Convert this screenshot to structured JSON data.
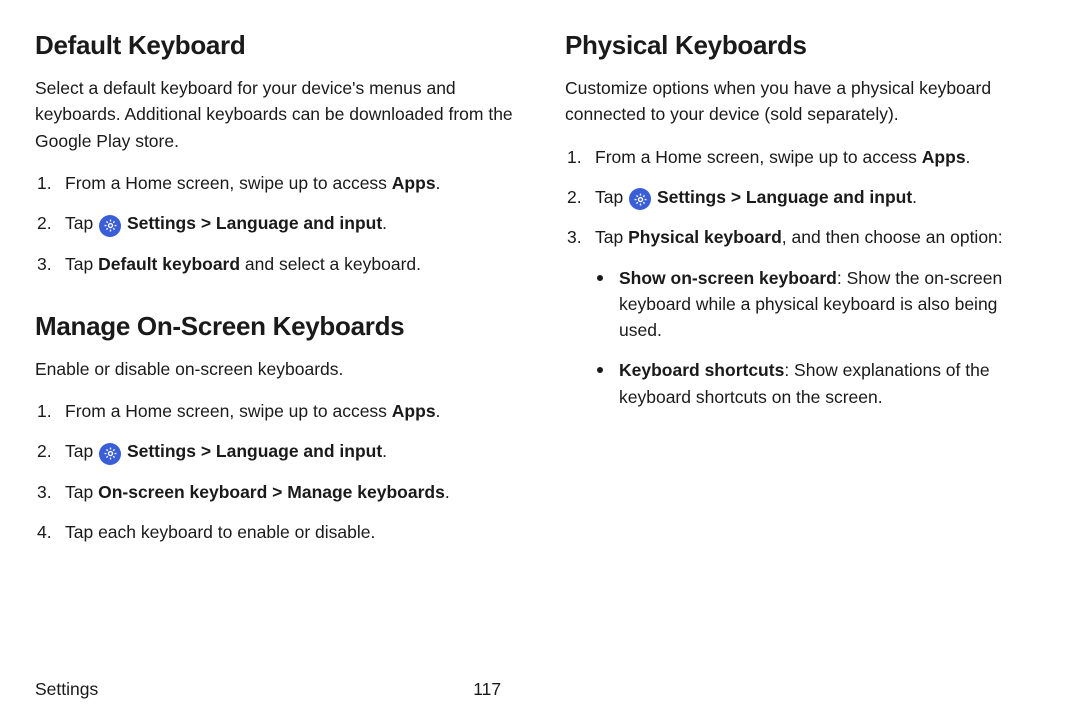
{
  "left": {
    "section1": {
      "heading": "Default Keyboard",
      "intro": "Select a default keyboard for your device's menus and keyboards. Additional keyboards can be downloaded from the Google Play store.",
      "step1_pre": "From a Home screen, swipe up to access ",
      "step1_bold": "Apps",
      "step1_post": ".",
      "step2_pre": "Tap ",
      "step2_bold": " Settings > Language and input",
      "step2_post": ".",
      "step3_pre": "Tap ",
      "step3_bold": "Default keyboard",
      "step3_post": " and select a keyboard."
    },
    "section2": {
      "heading": "Manage On-Screen Keyboards",
      "intro": "Enable or disable on-screen keyboards.",
      "step1_pre": "From a Home screen, swipe up to access ",
      "step1_bold": "Apps",
      "step1_post": ".",
      "step2_pre": "Tap ",
      "step2_bold": " Settings > Language and input",
      "step2_post": ".",
      "step3_pre": "Tap ",
      "step3_bold": "On-screen keyboard > Manage keyboards",
      "step3_post": ".",
      "step4": "Tap each keyboard to enable or disable."
    }
  },
  "right": {
    "section1": {
      "heading": "Physical Keyboards",
      "intro": "Customize options when you have a physical keyboard connected to your device (sold separately).",
      "step1_pre": "From a Home screen, swipe up to access ",
      "step1_bold": "Apps",
      "step1_post": ".",
      "step2_pre": "Tap ",
      "step2_bold": " Settings > Language and input",
      "step2_post": ".",
      "step3_pre": "Tap ",
      "step3_bold": "Physical keyboard",
      "step3_post": ", and then choose an option:",
      "bullet1_bold": "Show on-screen keyboard",
      "bullet1_text": ": Show the on-screen keyboard while a physical keyboard is also being used.",
      "bullet2_bold": "Keyboard shortcuts",
      "bullet2_text": ": Show explanations of the keyboard shortcuts on the screen."
    }
  },
  "footer": {
    "label": "Settings",
    "page": "117"
  }
}
